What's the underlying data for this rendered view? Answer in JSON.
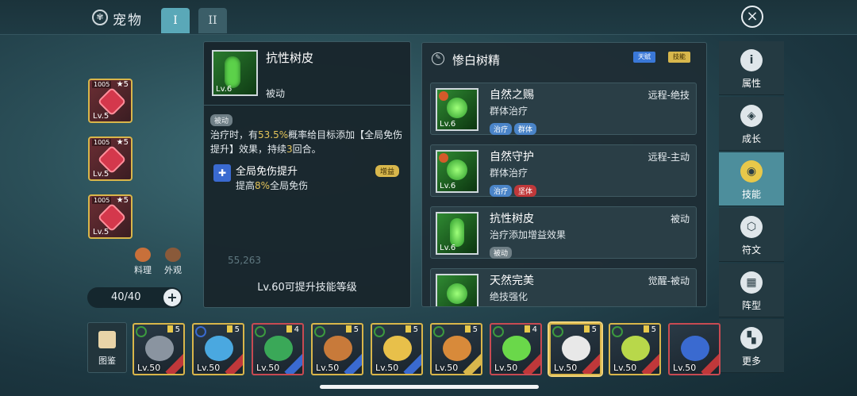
{
  "header": {
    "title": "宠物",
    "tabs": [
      "I",
      "II"
    ],
    "close_icon": "×"
  },
  "left_pets": [
    {
      "badge": "1005",
      "stars": "★5",
      "level": "Lv.5"
    },
    {
      "badge": "1005",
      "stars": "★5",
      "level": "Lv.5"
    },
    {
      "badge": "1005",
      "stars": "★5",
      "level": "Lv.5"
    }
  ],
  "left_actions": {
    "cook": "料理",
    "appearance": "外观"
  },
  "counter": {
    "value": "40/40",
    "plus": "+"
  },
  "tooltip": {
    "icon_level": "Lv.6",
    "name": "抗性树皮",
    "type": "被动",
    "tag": "被动",
    "desc_1": "治疗时，有",
    "desc_pct": "53.5%",
    "desc_2": "概率给目标添加【全局免伤提升】效果，持续",
    "desc_rounds": "3",
    "desc_3": "回合。",
    "buff_name": "全局免伤提升",
    "buff_tag": "增益",
    "buff_desc_1": "提高",
    "buff_desc_pct": "8%",
    "buff_desc_2": "全局免伤",
    "ghost_value": "55,263",
    "footer": "Lv.60可提升技能等级"
  },
  "skill_panel": {
    "title": "惨白树精",
    "badge_1": "天赋",
    "badge_2": "技能",
    "skills": [
      {
        "name": "自然之赐",
        "kind": "远程-绝技",
        "desc": "群体治疗",
        "level": "Lv.6",
        "tags": [
          {
            "label": "治疗",
            "color": "blue"
          },
          {
            "label": "群体",
            "color": "blue"
          }
        ]
      },
      {
        "name": "自然守护",
        "kind": "远程-主动",
        "desc": "群体治疗",
        "level": "Lv.6",
        "tags": [
          {
            "label": "治疗",
            "color": "blue"
          },
          {
            "label": "坚体",
            "color": "red"
          }
        ]
      },
      {
        "name": "抗性树皮",
        "kind": "被动",
        "desc": "治疗添加增益效果",
        "level": "Lv.6",
        "tags": [
          {
            "label": "被动",
            "color": "grey"
          }
        ]
      },
      {
        "name": "天然完美",
        "kind": "觉醒-被动",
        "desc": "绝技强化",
        "level": "",
        "tags": []
      }
    ]
  },
  "sidebar": [
    {
      "label": "属性",
      "icon": "info-icon",
      "glyph": "i"
    },
    {
      "label": "成长",
      "icon": "growth-icon",
      "glyph": "◈"
    },
    {
      "label": "技能",
      "icon": "skill-icon",
      "glyph": "◉"
    },
    {
      "label": "符文",
      "icon": "rune-icon",
      "glyph": "⬡"
    },
    {
      "label": "阵型",
      "icon": "formation-icon",
      "glyph": "▦"
    },
    {
      "label": "更多",
      "icon": "more-icon",
      "glyph": "▚"
    }
  ],
  "bottom": {
    "atlas_label": "图鉴",
    "cards": [
      {
        "level": "Lv.50",
        "count": "5",
        "face": "#8a94a0",
        "ring": "green",
        "ribbon": "#c0383a",
        "frame": "gold"
      },
      {
        "level": "Lv.50",
        "count": "5",
        "face": "#4aa8e0",
        "ring": "blue",
        "ribbon": "#c0383a",
        "frame": "gold"
      },
      {
        "level": "Lv.50",
        "count": "4",
        "face": "#3aa858",
        "ring": "green",
        "ribbon": "#3a6ad0",
        "frame": "red"
      },
      {
        "level": "Lv.50",
        "count": "5",
        "face": "#c87a3a",
        "ring": "green",
        "ribbon": "#3a6ad0",
        "frame": "gold"
      },
      {
        "level": "Lv.50",
        "count": "5",
        "face": "#e8c04a",
        "ring": "green",
        "ribbon": "#3a6ad0",
        "frame": "gold"
      },
      {
        "level": "Lv.50",
        "count": "5",
        "face": "#d88a3a",
        "ring": "green",
        "ribbon": "#d8b74c",
        "frame": "gold"
      },
      {
        "level": "Lv.50",
        "count": "4",
        "face": "#6ad84a",
        "ring": "green",
        "ribbon": "#c0383a",
        "frame": "red"
      },
      {
        "level": "Lv.50",
        "count": "5",
        "face": "#e8e8e8",
        "ring": "green",
        "ribbon": "#c0383a",
        "frame": "sel"
      },
      {
        "level": "Lv.50",
        "count": "5",
        "face": "#b8d84a",
        "ring": "green",
        "ribbon": "#c0383a",
        "frame": "gold"
      },
      {
        "level": "Lv.50",
        "count": "",
        "face": "#3a6ad0",
        "ring": "none",
        "ribbon": "#c0383a",
        "frame": "red"
      }
    ]
  }
}
